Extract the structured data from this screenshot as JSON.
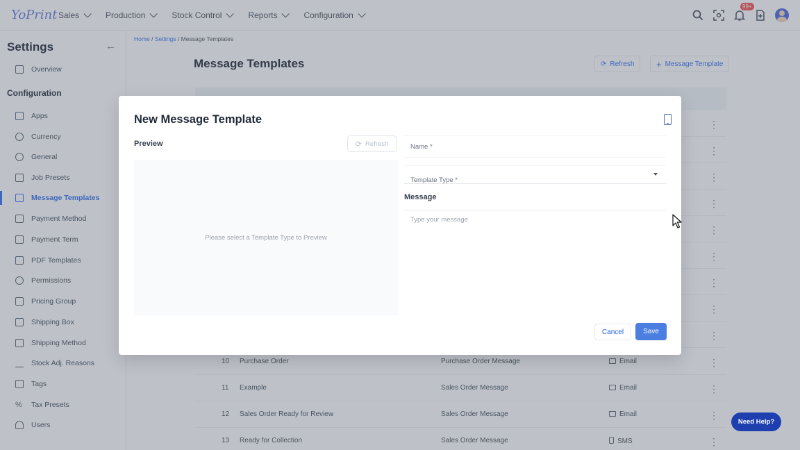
{
  "app": {
    "logo_text": "YoPrint"
  },
  "nav": {
    "items": [
      {
        "label": "Sales"
      },
      {
        "label": "Production"
      },
      {
        "label": "Stock Control"
      },
      {
        "label": "Reports"
      },
      {
        "label": "Configuration"
      }
    ],
    "notification_count": "99+"
  },
  "sidebar": {
    "title": "Settings",
    "overview_label": "Overview",
    "section_label": "Configuration",
    "items": [
      {
        "label": "Apps",
        "icon": "apps-grid-icon"
      },
      {
        "label": "Currency",
        "icon": "currency-icon"
      },
      {
        "label": "General",
        "icon": "gear-icon"
      },
      {
        "label": "Job Presets",
        "icon": "briefcase-icon"
      },
      {
        "label": "Message Templates",
        "icon": "message-icon",
        "active": true
      },
      {
        "label": "Payment Method",
        "icon": "card-icon"
      },
      {
        "label": "Payment Term",
        "icon": "document-icon"
      },
      {
        "label": "PDF Templates",
        "icon": "pdf-icon"
      },
      {
        "label": "Permissions",
        "icon": "permissions-icon"
      },
      {
        "label": "Pricing Group",
        "icon": "tag-icon"
      },
      {
        "label": "Shipping Box",
        "icon": "box-icon"
      },
      {
        "label": "Shipping Method",
        "icon": "truck-icon"
      },
      {
        "label": "Stock Adj. Reasons",
        "icon": "list-edit-icon"
      },
      {
        "label": "Tags",
        "icon": "label-icon"
      },
      {
        "label": "Tax Presets",
        "icon": "percent-icon"
      },
      {
        "label": "Users",
        "icon": "users-icon"
      }
    ]
  },
  "breadcrumb": {
    "home": "Home",
    "sep": "/",
    "settings": "Settings",
    "current": "Message Templates"
  },
  "page": {
    "title": "Message Templates",
    "refresh_label": "Refresh",
    "add_label": "Message Template"
  },
  "table": {
    "rows": [
      {
        "no": "10",
        "name": "Purchase Order",
        "type": "Purchase Order Message",
        "channel": "Email"
      },
      {
        "no": "11",
        "name": "Example",
        "type": "Sales Order Message",
        "channel": "Email"
      },
      {
        "no": "12",
        "name": "Sales Order Ready for Review",
        "type": "Sales Order Message",
        "channel": "Email"
      },
      {
        "no": "13",
        "name": "Ready for Collection",
        "type": "Sales Order Message",
        "channel": "SMS"
      }
    ]
  },
  "modal": {
    "title": "New Message Template",
    "preview_label": "Preview",
    "preview_refresh_label": "Refresh",
    "preview_empty": "Please select a Template Type to Preview",
    "name_label": "Name *",
    "template_type_label": "Template Type *",
    "message_label": "Message",
    "message_placeholder": "Type your message",
    "cancel_label": "Cancel",
    "save_label": "Save"
  },
  "help": {
    "label": "Need Help?"
  },
  "colors": {
    "accent": "#2563eb",
    "save": "#4a7ee0",
    "help": "#1e40af",
    "badge": "#ef4444"
  }
}
